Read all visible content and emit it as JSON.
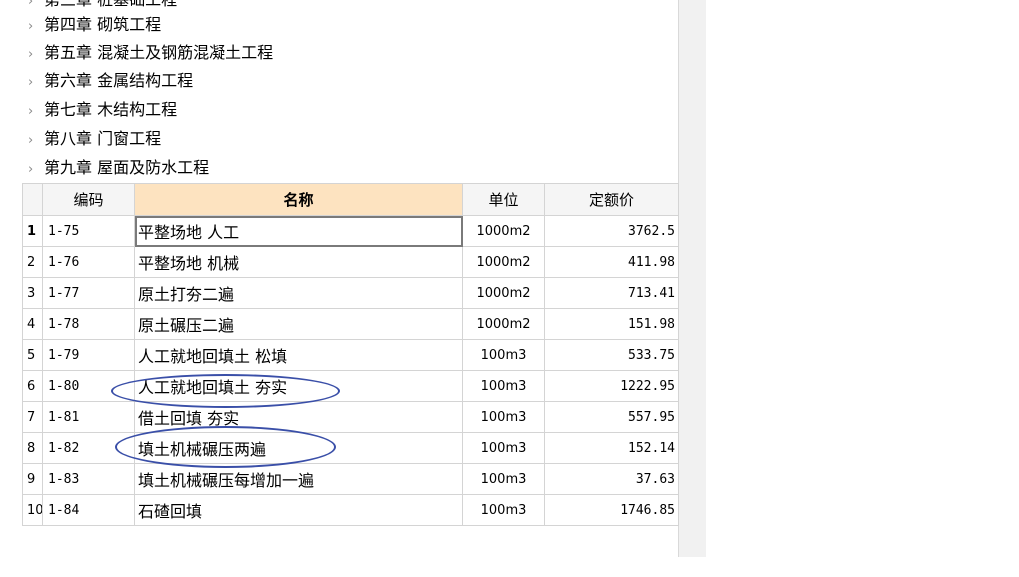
{
  "tree": {
    "items": [
      {
        "label": "第三章 桩基础工程"
      },
      {
        "label": "第四章 砌筑工程"
      },
      {
        "label": "第五章 混凝土及钢筋混凝土工程"
      },
      {
        "label": "第六章 金属结构工程"
      },
      {
        "label": "第七章 木结构工程"
      },
      {
        "label": "第八章 门窗工程"
      },
      {
        "label": "第九章 屋面及防水工程"
      }
    ],
    "chevron": "›"
  },
  "table": {
    "headers": {
      "code": "编码",
      "name": "名称",
      "unit": "单位",
      "price": "定额价"
    },
    "rows": [
      {
        "num": "1",
        "code": "1-75",
        "name": "平整场地 人工",
        "unit": "1000m2",
        "price": "3762.5"
      },
      {
        "num": "2",
        "code": "1-76",
        "name": "平整场地 机械",
        "unit": "1000m2",
        "price": "411.98"
      },
      {
        "num": "3",
        "code": "1-77",
        "name": "原土打夯二遍",
        "unit": "1000m2",
        "price": "713.41"
      },
      {
        "num": "4",
        "code": "1-78",
        "name": "原土碾压二遍",
        "unit": "1000m2",
        "price": "151.98"
      },
      {
        "num": "5",
        "code": "1-79",
        "name": "人工就地回填土 松填",
        "unit": "100m3",
        "price": "533.75"
      },
      {
        "num": "6",
        "code": "1-80",
        "name": "人工就地回填土 夯实",
        "unit": "100m3",
        "price": "1222.95"
      },
      {
        "num": "7",
        "code": "1-81",
        "name": "借土回填 夯实",
        "unit": "100m3",
        "price": "557.95"
      },
      {
        "num": "8",
        "code": "1-82",
        "name": "填土机械碾压两遍",
        "unit": "100m3",
        "price": "152.14"
      },
      {
        "num": "9",
        "code": "1-83",
        "name": "填土机械碾压每增加一遍",
        "unit": "100m3",
        "price": "37.63"
      },
      {
        "num": "10",
        "code": "1-84",
        "name": "石碴回填",
        "unit": "100m3",
        "price": "1746.85"
      }
    ]
  },
  "colors": {
    "annotation": "#3a4fa8",
    "selected_header": "#fde3c0"
  }
}
